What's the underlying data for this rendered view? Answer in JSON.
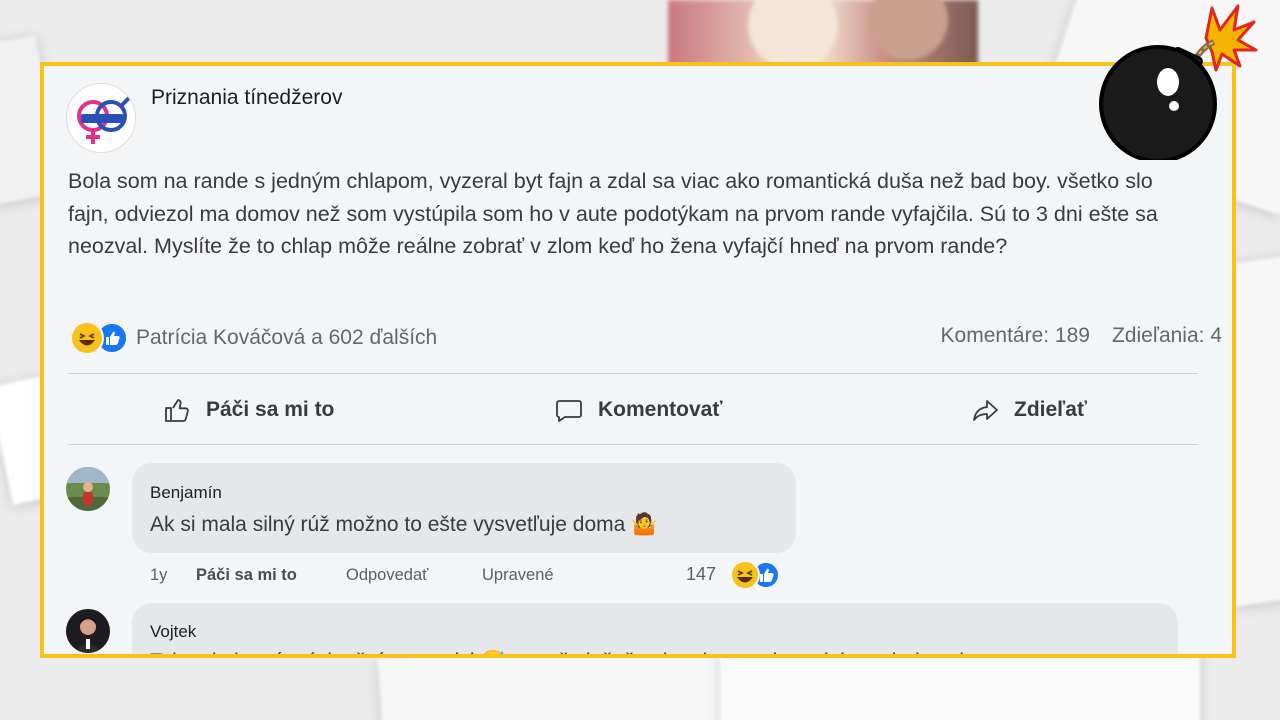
{
  "post": {
    "page_name": "Priznania tínedžerov",
    "text": "Bola som na rande s jedným chlapom, vyzeral byt fajn a zdal sa viac ako romantická duša než bad boy. všetko slo fajn, odviezol ma domov než som vystúpila som ho v aute podotýkam na prvom rande vyfajčila. Sú to 3 dni ešte sa neozval. Myslíte že to chlap môže reálne zobrať v zlom keď ho žena vyfajčí hneď na prvom rande?",
    "reactions_text": "Patrícia Kováčová a 602 ďalších",
    "comments_count": "Komentáre: 189",
    "shares_count": "Zdieľania: 4"
  },
  "actions": {
    "like": "Páči sa mi to",
    "comment": "Komentovať",
    "share": "Zdieľať"
  },
  "comments": [
    {
      "author": "Benjamín",
      "text": "Ak si mala silný rúž možno to ešte vysvetľuje doma 🤷",
      "time": "1y",
      "like": "Páči sa mi to",
      "reply": "Odpovedať",
      "edited": "Upravené",
      "reaction_count": "147"
    },
    {
      "author": "Vojtek",
      "text": "Tak to je jasné - tí dnešní romantici 😅 aspoň vieš, že si mala pravdu... ak by to bol ozaj"
    }
  ],
  "colors": {
    "frame": "#f7c21b",
    "like_blue": "#1877f2",
    "haha_yellow": "#f7c21b"
  },
  "icons": [
    "bomb-icon",
    "like-icon",
    "comment-icon",
    "share-icon",
    "haha-reaction-icon",
    "like-reaction-icon"
  ]
}
